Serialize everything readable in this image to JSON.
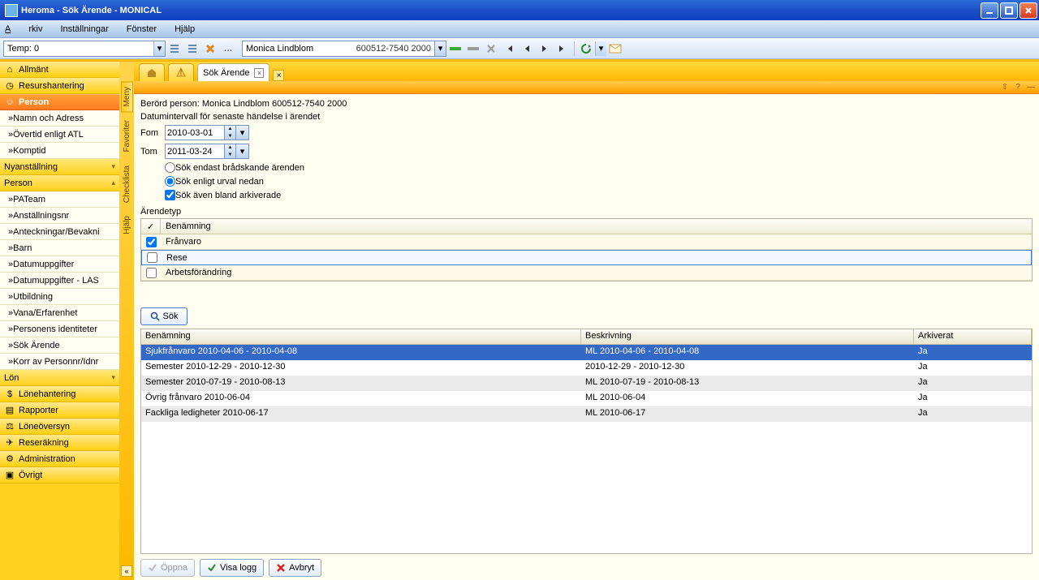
{
  "window": {
    "title": "Heroma - Sök Ärende - MONICAL"
  },
  "menu": {
    "arkiv": "Arkiv",
    "installningar": "Inställningar",
    "fonster": "Fönster",
    "hjalp": "Hjälp"
  },
  "toolbar": {
    "temp_label": "Temp: 0",
    "person_name": "Monica Lindblom",
    "person_id": "600512-7540 2000"
  },
  "sidebar": {
    "allmant": "Allmänt",
    "resurshantering": "Resurshantering",
    "person": "Person",
    "namn_adress": "Namn och Adress",
    "overtid": "Övertid enligt ATL",
    "komptid": "Komptid",
    "nyanstallning": "Nyanställning",
    "person_cat": "Person",
    "pateam": "PATeam",
    "anstallningsnr": "Anställningsnr",
    "anteckningar": "Anteckningar/Bevakni",
    "barn": "Barn",
    "datumuppgifter": "Datumuppgifter",
    "datumuppgifter_las": "Datumuppgifter - LAS",
    "utbildning": "Utbildning",
    "vana": "Vana/Erfarenhet",
    "personens_id": "Personens identiteter",
    "sok_arende": "Sök Ärende",
    "korr": "Korr av Personnr/Idnr",
    "lon": "Lön",
    "lonehantering": "Lönehantering",
    "rapporter": "Rapporter",
    "loneoversyn": "Löneöversyn",
    "reserakning": "Reseräkning",
    "administration": "Administration",
    "ovrigt": "Övrigt"
  },
  "vtabs": {
    "meny": "Meny",
    "favoriter": "Favoriter",
    "checklista": "Checklista",
    "hjalp": "Hjälp"
  },
  "tabs": {
    "sok_arende": "Sök Ärende"
  },
  "form": {
    "berord_person": "Berörd person: Monica Lindblom 600512-7540 2000",
    "datumintervall": "Datumintervall för senaste händelse i ärendet",
    "fom_lbl": "Fom",
    "fom_val": "2010-03-01",
    "tom_lbl": "Tom",
    "tom_val": "2011-03-24",
    "radio_bradskande": "Sök endast brådskande ärenden",
    "radio_urval": "Sök enligt urval nedan",
    "chk_arkiverade": "Sök även bland arkiverade",
    "arendetyp_lbl": "Ärendetyp",
    "col_benamning": "Benämning",
    "types": [
      {
        "checked": true,
        "name": "Frånvaro"
      },
      {
        "checked": false,
        "name": "Rese"
      },
      {
        "checked": false,
        "name": "Arbetsförändring"
      }
    ],
    "sok_btn": "Sök"
  },
  "results": {
    "col_benamning": "Benämning",
    "col_beskrivning": "Beskrivning",
    "col_arkiverat": "Arkiverat",
    "rows": [
      {
        "ben": "Sjukfrånvaro  2010-04-06 - 2010-04-08",
        "besk": "ML 2010-04-06 - 2010-04-08",
        "ark": "Ja",
        "sel": true
      },
      {
        "ben": "Semester  2010-12-29 - 2010-12-30",
        "besk": "2010-12-29 - 2010-12-30",
        "ark": "Ja"
      },
      {
        "ben": "Semester  2010-07-19 - 2010-08-13",
        "besk": "ML 2010-07-19 - 2010-08-13",
        "ark": "Ja"
      },
      {
        "ben": "Övrig frånvaro  2010-06-04",
        "besk": "ML 2010-06-04",
        "ark": "Ja"
      },
      {
        "ben": "Fackliga ledigheter  2010-06-17",
        "besk": "ML 2010-06-17",
        "ark": "Ja"
      }
    ]
  },
  "buttons": {
    "oppna": "Öppna",
    "visa_logg": "Visa logg",
    "avbryt": "Avbryt"
  }
}
